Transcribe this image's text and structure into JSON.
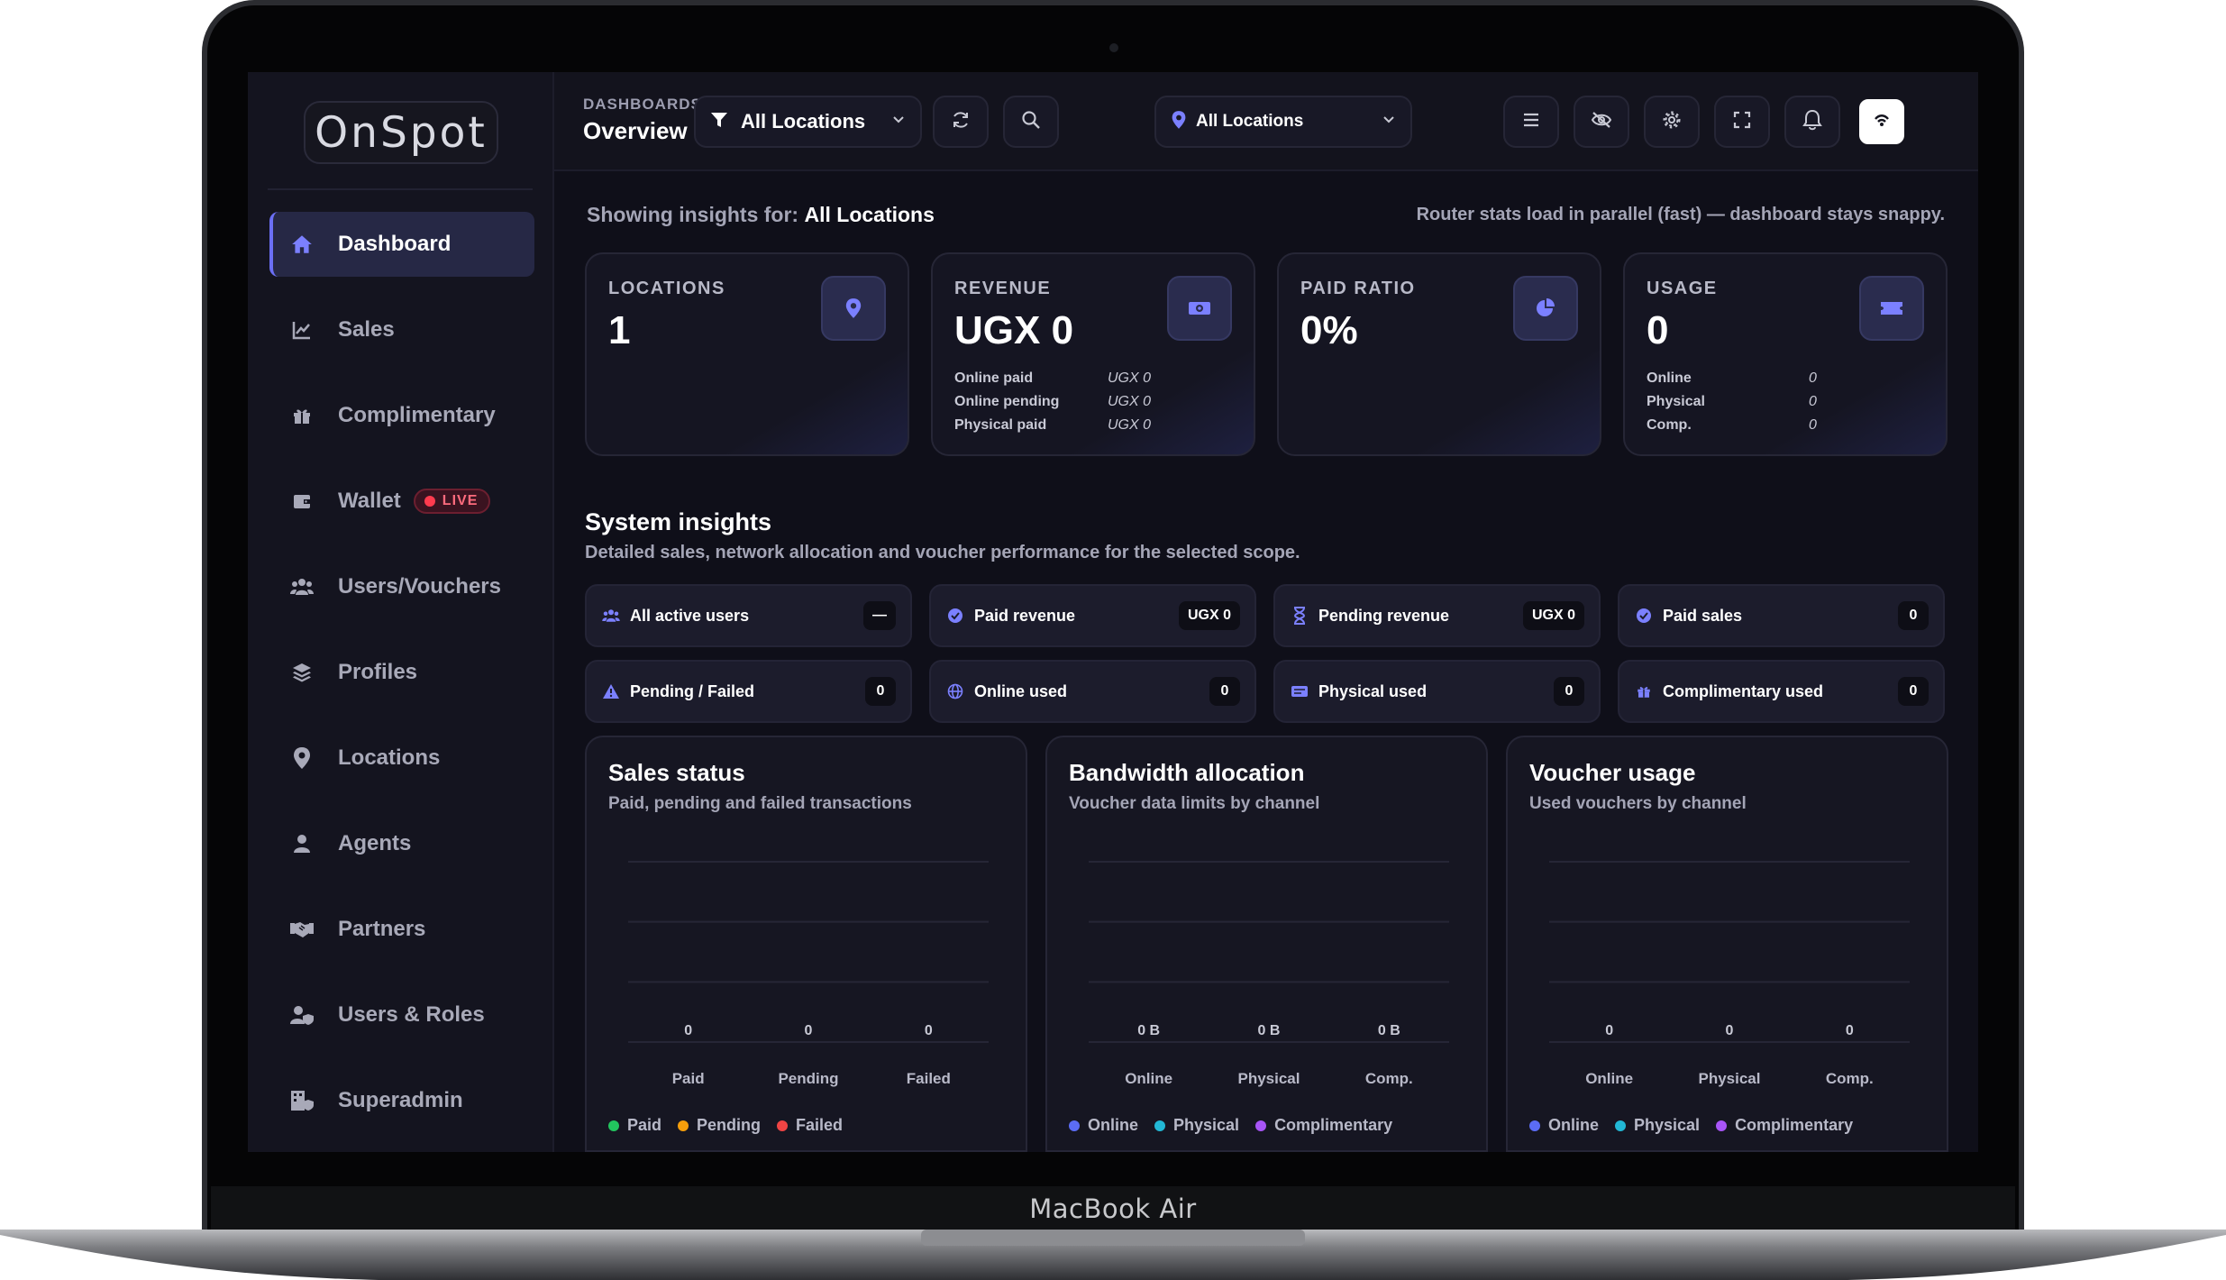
{
  "device": {
    "label": "MacBook Air"
  },
  "brand": {
    "logo_text": "OnSpot"
  },
  "sidebar": {
    "items": [
      {
        "label": "Dashboard",
        "icon": "home-icon",
        "active": true
      },
      {
        "label": "Sales",
        "icon": "chart-line-icon"
      },
      {
        "label": "Complimentary",
        "icon": "gift-icon"
      },
      {
        "label": "Wallet",
        "icon": "wallet-icon",
        "badge": "LIVE"
      },
      {
        "label": "Users/Vouchers",
        "icon": "users-icon"
      },
      {
        "label": "Profiles",
        "icon": "layers-icon"
      },
      {
        "label": "Locations",
        "icon": "map-pin-icon"
      },
      {
        "label": "Agents",
        "icon": "agent-icon"
      },
      {
        "label": "Partners",
        "icon": "handshake-icon"
      },
      {
        "label": "Users & Roles",
        "icon": "user-shield-icon"
      },
      {
        "label": "Superadmin",
        "icon": "building-shield-icon"
      }
    ]
  },
  "topbar": {
    "section": "DASHBOARDS",
    "page": "Overview",
    "filter_location": "All Locations",
    "location_select": "All Locations"
  },
  "header": {
    "insights_prefix": "Showing insights for:",
    "insights_scope": "All Locations",
    "router_note": "Router stats load in parallel (fast) — dashboard stays snappy."
  },
  "kpis": {
    "locations": {
      "title": "LOCATIONS",
      "value": "1"
    },
    "revenue": {
      "title": "REVENUE",
      "value": "UGX 0",
      "rows": [
        {
          "label": "Online paid",
          "value": "UGX 0"
        },
        {
          "label": "Online pending",
          "value": "UGX 0"
        },
        {
          "label": "Physical paid",
          "value": "UGX 0"
        }
      ]
    },
    "paid_ratio": {
      "title": "PAID RATIO",
      "value": "0%"
    },
    "usage": {
      "title": "USAGE",
      "value": "0",
      "rows": [
        {
          "label": "Online",
          "value": "0"
        },
        {
          "label": "Physical",
          "value": "0"
        },
        {
          "label": "Comp.",
          "value": "0"
        }
      ]
    }
  },
  "system_insights": {
    "title": "System insights",
    "subtitle": "Detailed sales, network allocation and voucher performance for the selected scope.",
    "pills": [
      {
        "label": "All active users",
        "value": "—"
      },
      {
        "label": "Paid revenue",
        "value": "UGX 0"
      },
      {
        "label": "Pending revenue",
        "value": "UGX 0"
      },
      {
        "label": "Paid sales",
        "value": "0"
      },
      {
        "label": "Pending / Failed",
        "value": "0"
      },
      {
        "label": "Online used",
        "value": "0"
      },
      {
        "label": "Physical used",
        "value": "0"
      },
      {
        "label": "Complimentary used",
        "value": "0"
      }
    ]
  },
  "colors": {
    "accent": "#6b6ff5",
    "paid": "#22c55e",
    "pending": "#f59e0b",
    "failed": "#ef4444",
    "online": "#5b6cf5",
    "physical": "#22b8d6",
    "complimentary": "#a855f7"
  },
  "chart_data": [
    {
      "type": "bar",
      "title": "Sales status",
      "subtitle": "Paid, pending and failed transactions",
      "categories": [
        "Paid",
        "Pending",
        "Failed"
      ],
      "values": [
        0,
        0,
        0
      ],
      "value_labels": [
        "0",
        "0",
        "0"
      ],
      "legend": [
        "Paid",
        "Pending",
        "Failed"
      ],
      "legend_colors": [
        "#22c55e",
        "#f59e0b",
        "#ef4444"
      ],
      "grid": true
    },
    {
      "type": "bar",
      "title": "Bandwidth allocation",
      "subtitle": "Voucher data limits by channel",
      "categories": [
        "Online",
        "Physical",
        "Comp."
      ],
      "values": [
        0,
        0,
        0
      ],
      "value_labels": [
        "0 B",
        "0 B",
        "0 B"
      ],
      "legend": [
        "Online",
        "Physical",
        "Complimentary"
      ],
      "legend_colors": [
        "#5b6cf5",
        "#22b8d6",
        "#a855f7"
      ],
      "grid": true
    },
    {
      "type": "bar",
      "title": "Voucher usage",
      "subtitle": "Used vouchers by channel",
      "categories": [
        "Online",
        "Physical",
        "Comp."
      ],
      "values": [
        0,
        0,
        0
      ],
      "value_labels": [
        "0",
        "0",
        "0"
      ],
      "legend": [
        "Online",
        "Physical",
        "Complimentary"
      ],
      "legend_colors": [
        "#5b6cf5",
        "#22b8d6",
        "#a855f7"
      ],
      "grid": true
    }
  ]
}
